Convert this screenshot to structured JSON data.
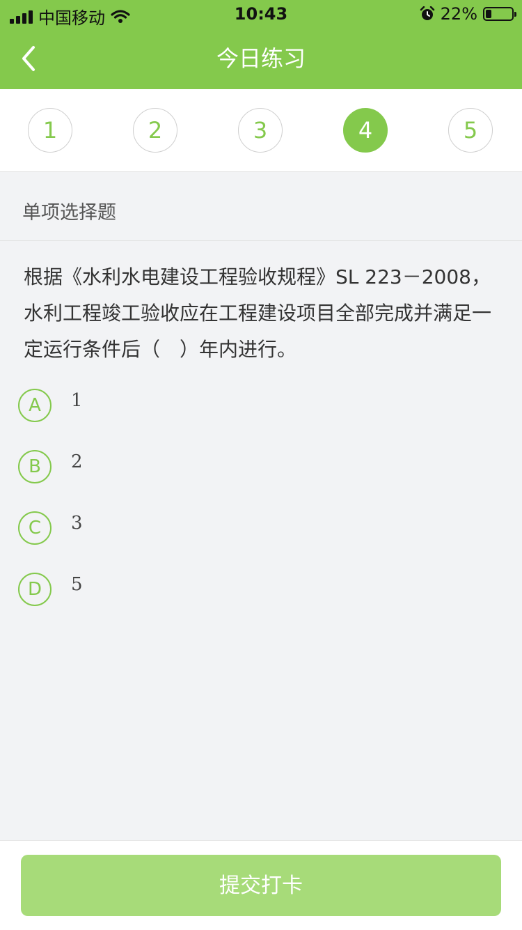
{
  "status_bar": {
    "carrier": "中国移动",
    "time": "10:43",
    "battery": "22%",
    "battery_level": 0.22
  },
  "header": {
    "title": "今日练习",
    "back_icon": "chevron-left-icon"
  },
  "steps": [
    "1",
    "2",
    "3",
    "4",
    "5"
  ],
  "active_step": "4",
  "question": {
    "type": "单项选择题",
    "text": "根据《水利水电建设工程验收规程》SL 223－2008，水利工程竣工验收应在工程建设项目全部完成并满足一定运行条件后（　）年内进行。",
    "options": [
      {
        "letter": "A",
        "text": "1"
      },
      {
        "letter": "B",
        "text": "2"
      },
      {
        "letter": "C",
        "text": "3"
      },
      {
        "letter": "D",
        "text": "5"
      }
    ]
  },
  "footer": {
    "submit_label": "提交打卡"
  },
  "colors": {
    "brand": "#84c94c",
    "submit_disabled": "#a7db79"
  }
}
